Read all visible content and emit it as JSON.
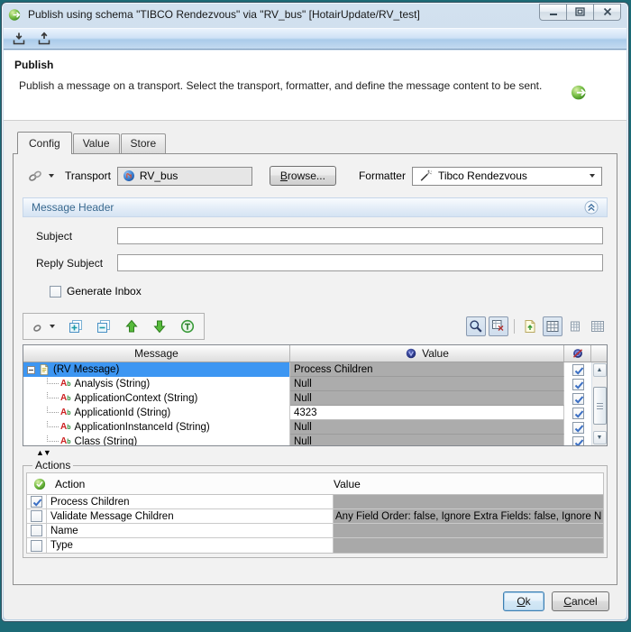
{
  "window": {
    "title": "Publish using schema \"TIBCO Rendezvous\" via \"RV_bus\" [HotairUpdate/RV_test]"
  },
  "banner": {
    "title": "Publish",
    "description": "Publish a message on a transport. Select the transport, formatter, and define the message content to be sent."
  },
  "tabs": [
    {
      "label": "Config",
      "active": true
    },
    {
      "label": "Value",
      "active": false
    },
    {
      "label": "Store",
      "active": false
    }
  ],
  "config": {
    "transport_label": "Transport",
    "transport_value": "RV_bus",
    "browse_label": "Browse...",
    "formatter_label": "Formatter",
    "formatter_value": "Tibco Rendezvous",
    "message_header": {
      "title": "Message Header",
      "subject_label": "Subject",
      "subject_value": "",
      "reply_subject_label": "Reply Subject",
      "reply_subject_value": "",
      "generate_inbox_label": "Generate Inbox",
      "generate_inbox_checked": false
    }
  },
  "message_table": {
    "columns": {
      "message": "Message",
      "value": "Value"
    },
    "rows": [
      {
        "name": "(RV Message)",
        "value": "Process Children",
        "checked": true,
        "selected": true
      },
      {
        "name": "Analysis (String)",
        "value": "Null",
        "checked": true
      },
      {
        "name": "ApplicationContext (String)",
        "value": "Null",
        "checked": true
      },
      {
        "name": "ApplicationId (String)",
        "value": "4323",
        "checked": true
      },
      {
        "name": "ApplicationInstanceId (String)",
        "value": "Null",
        "checked": true
      },
      {
        "name": "Class (String)",
        "value": "Null",
        "checked": true
      }
    ]
  },
  "actions": {
    "group_label": "Actions",
    "columns": {
      "action": "Action",
      "value": "Value"
    },
    "rows": [
      {
        "label": "Process Children",
        "value": "",
        "checked": true
      },
      {
        "label": "Validate Message Children",
        "value": "Any Field Order: false, Ignore Extra Fields: false, Ignore N",
        "checked": false
      },
      {
        "label": "Name",
        "value": "",
        "checked": false
      },
      {
        "label": "Type",
        "value": "",
        "checked": false
      }
    ]
  },
  "footer": {
    "ok_label": "Ok",
    "cancel_label": "Cancel"
  },
  "colors": {
    "selection_blue": "#3d96f2",
    "value_cell_gray": "#acacac",
    "section_link_blue": "#39698f",
    "desktop_teal": "#1c6a76"
  }
}
